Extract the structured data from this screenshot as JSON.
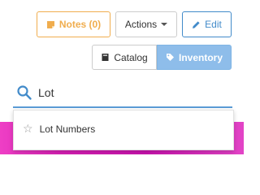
{
  "toolbar": {
    "notes_label": "Notes (0)",
    "actions_label": "Actions",
    "edit_label": "Edit",
    "colors": {
      "warning": "#f0ad4e",
      "primary": "#428bca"
    }
  },
  "view_toggle": {
    "catalog_label": "Catalog",
    "inventory_label": "Inventory",
    "active": "Inventory",
    "active_color": "#8ebdea"
  },
  "search": {
    "value": "Lot",
    "icon": "search-icon"
  },
  "suggestions": [
    {
      "label": "Lot Numbers",
      "icon": "star-icon"
    }
  ]
}
